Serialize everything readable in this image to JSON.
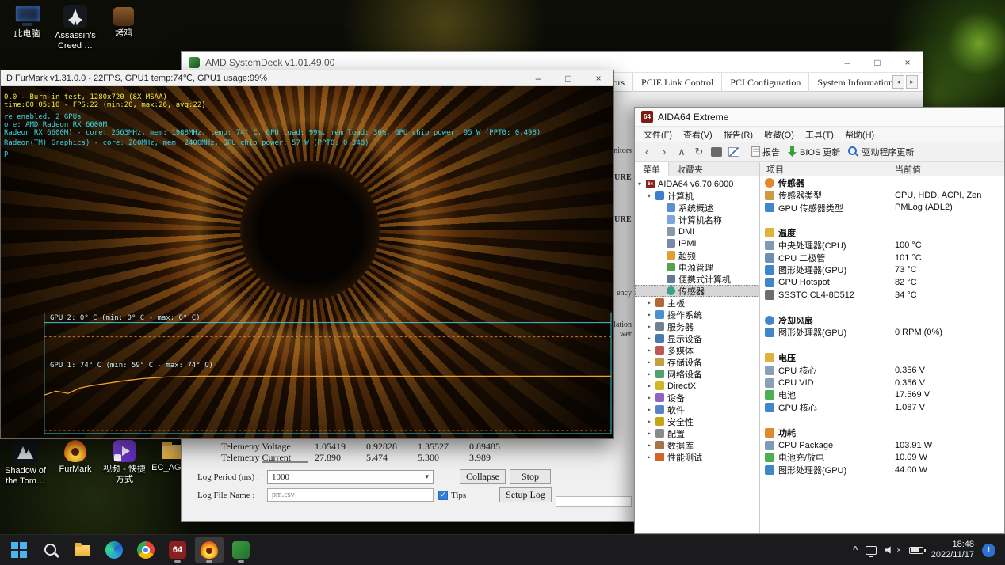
{
  "icons": {
    "minimize": "–",
    "maximize": "□",
    "close": "×",
    "back": "‹",
    "forward": "›",
    "up": "∧",
    "refresh": "↻",
    "combo_arrow": "▾",
    "check": "✓",
    "tray_chevron": "^",
    "tab_left": "◂",
    "tab_right": "▸",
    "aida_glyph": "64"
  },
  "desktop": {
    "icons_top": [
      "此电脑",
      "Assassin's Creed …",
      "烤鸡"
    ],
    "icons_bottom": [
      "Shadow of the Tom…",
      "FurMark",
      "视频 - 快捷方式",
      "EC_AGS…"
    ]
  },
  "furmark": {
    "title": "D FurMark v1.31.0.0 - 22FPS, GPU1 temp:74℃, GPU1 usage:99%",
    "overlay_lines": [
      {
        "text": "0.0 - Burn-in test, 1280x720 (8X MSAA)",
        "cls": "yellow"
      },
      {
        "text": "time:00:05:10 - FPS:22 (min:20, max:26, avg:22)",
        "cls": "yellow"
      },
      {
        "text": "re enabled, 2 GPUs",
        "cls": "cyan g1"
      },
      {
        "text": "ore: AMD Radeon RX 6600M",
        "cls": "cyan"
      },
      {
        "text": "Radeon RX 6600M) - core: 2563MHz, mem: 1988MHz, temp: 74° C, GPU load: 99%, mem load: 36%, GPU chip power: 95 W (PPT0: 0.498)",
        "cls": "cyan"
      },
      {
        "text": "Radeon(TM) Graphics) - core: 200MHz, mem: 2400MHz, GPU chip power: 57 W (PPT0: 0.348)",
        "cls": "cyan g2"
      },
      {
        "text": "p",
        "cls": "cyan g2"
      }
    ],
    "graph": {
      "gpu2_label": "GPU 2: 0° C (min: 0° C - max: 0° C)",
      "gpu1_label": "GPU 1: 74° C (min: 59° C - max: 74° C)"
    }
  },
  "systemdeck": {
    "title": "AMD SystemDeck v1.01.49.00",
    "tabs": [
      "Monitors",
      "PCIE Link Control",
      "PCI Configuration",
      "System Information"
    ],
    "fragments": [
      {
        "text": "onitors",
        "cls": "f1"
      },
      {
        "text": "CTURE",
        "cls": "f2"
      },
      {
        "text": "CTURE",
        "cls": "f3"
      },
      {
        "text": "ency",
        "cls": "f4"
      },
      {
        "text": "lation",
        "cls": "f5"
      },
      {
        "text": "wer",
        "cls": "f6"
      }
    ],
    "table_rows": [
      {
        "label": "Telemetry Voltage",
        "values": [
          "1.05419",
          "0.92828",
          "1.35527",
          "0.89485"
        ]
      },
      {
        "label": "Telemetry Current",
        "values": [
          "27.890",
          "5.474",
          "5.300",
          "3.989"
        ]
      }
    ],
    "log_period_label": "Log Period (ms) :",
    "log_period_value": "1000",
    "collapse_button": "Collapse",
    "stop_button": "Stop",
    "log_file_label": "Log File Name :",
    "log_file_value": "pm.csv",
    "tips_label": "Tips",
    "setup_button": "Setup Log"
  },
  "aida64": {
    "title": "AIDA64 Extreme",
    "menu": [
      "文件(F)",
      "查看(V)",
      "报告(R)",
      "收藏(O)",
      "工具(T)",
      "帮助(H)"
    ],
    "toolbar": {
      "report": "报告",
      "bios": "BIOS 更新",
      "driver": "驱动程序更新"
    },
    "nav_tabs": [
      "菜单",
      "收藏夹"
    ],
    "tree": [
      {
        "label": "AIDA64 v6.70.6000",
        "arrow": "▾",
        "icon": "aida",
        "glyph": "64",
        "cls": "d0"
      },
      {
        "label": "计算机",
        "arrow": "▾",
        "icon": "computer",
        "cls": "d1"
      },
      {
        "label": "系统概述",
        "arrow": "",
        "icon": "overview",
        "cls": "d2"
      },
      {
        "label": "计算机名称",
        "arrow": "",
        "icon": "name",
        "cls": "d2"
      },
      {
        "label": "DMI",
        "arrow": "",
        "icon": "dmi",
        "cls": "d2"
      },
      {
        "label": "IPMI",
        "arrow": "",
        "icon": "ipmi",
        "cls": "d2"
      },
      {
        "label": "超频",
        "arrow": "",
        "icon": "oc",
        "cls": "d2"
      },
      {
        "label": "电源管理",
        "arrow": "",
        "icon": "power",
        "cls": "d2"
      },
      {
        "label": "便携式计算机",
        "arrow": "",
        "icon": "laptop",
        "cls": "d2"
      },
      {
        "label": "传感器",
        "arrow": "",
        "icon": "sensor",
        "cls": "d2 sel"
      },
      {
        "label": "主板",
        "arrow": "▸",
        "icon": "board",
        "cls": "d1"
      },
      {
        "label": "操作系统",
        "arrow": "▸",
        "icon": "os",
        "cls": "d1"
      },
      {
        "label": "服务器",
        "arrow": "▸",
        "icon": "server",
        "cls": "d1"
      },
      {
        "label": "显示设备",
        "arrow": "▸",
        "icon": "display",
        "cls": "d1"
      },
      {
        "label": "多媒体",
        "arrow": "▸",
        "icon": "media",
        "cls": "d1"
      },
      {
        "label": "存储设备",
        "arrow": "▸",
        "icon": "storage",
        "cls": "d1"
      },
      {
        "label": "网络设备",
        "arrow": "▸",
        "icon": "network",
        "cls": "d1"
      },
      {
        "label": "DirectX",
        "arrow": "▸",
        "icon": "directx",
        "cls": "d1"
      },
      {
        "label": "设备",
        "arrow": "▸",
        "icon": "devices",
        "cls": "d1"
      },
      {
        "label": "软件",
        "arrow": "▸",
        "icon": "software",
        "cls": "d1"
      },
      {
        "label": "安全性",
        "arrow": "▸",
        "icon": "security",
        "cls": "d1"
      },
      {
        "label": "配置",
        "arrow": "▸",
        "icon": "config",
        "cls": "d1"
      },
      {
        "label": "数据库",
        "arrow": "▸",
        "icon": "database",
        "cls": "d1"
      },
      {
        "label": "性能测试",
        "arrow": "▸",
        "icon": "benchmark",
        "cls": "d1"
      }
    ],
    "columns": {
      "item": "项目",
      "value": "当前值"
    },
    "rows": [
      {
        "label": "传感器",
        "cls": "section",
        "icon": "sensor"
      },
      {
        "label": "传感器类型",
        "value": "CPU, HDD, ACPI, Zen",
        "cls": "item",
        "icon": "sensor-type"
      },
      {
        "label": "GPU 传感器类型",
        "value": "PMLog (ADL2)",
        "cls": "item",
        "icon": "gpu-sensor"
      },
      {
        "cls": "blank"
      },
      {
        "label": "温度",
        "cls": "section",
        "icon": "temperature"
      },
      {
        "label": "中央处理器(CPU)",
        "value": "100 °C",
        "cls": "item",
        "icon": "cpu"
      },
      {
        "label": "CPU 二极管",
        "value": "101 °C",
        "cls": "item",
        "icon": "diode"
      },
      {
        "label": "图形处理器(GPU)",
        "value": "73 °C",
        "cls": "item",
        "icon": "gpu"
      },
      {
        "label": "GPU Hotspot",
        "value": "82 °C",
        "cls": "item",
        "icon": "gpu"
      },
      {
        "label": "SSSTC CL4-8D512",
        "value": "34 °C",
        "cls": "item",
        "icon": "disk"
      },
      {
        "cls": "blank"
      },
      {
        "label": "冷却风扇",
        "cls": "section",
        "icon": "fan"
      },
      {
        "label": "图形处理器(GPU)",
        "value": "0 RPM (0%)",
        "cls": "item",
        "icon": "gpu"
      },
      {
        "cls": "blank"
      },
      {
        "label": "电压",
        "cls": "section",
        "icon": "voltage"
      },
      {
        "label": "CPU 核心",
        "value": "0.356 V",
        "cls": "item",
        "icon": "core"
      },
      {
        "label": "CPU VID",
        "value": "0.356 V",
        "cls": "item",
        "icon": "core"
      },
      {
        "label": "电池",
        "value": "17.569 V",
        "cls": "item",
        "icon": "battery"
      },
      {
        "label": "GPU 核心",
        "value": "1.087 V",
        "cls": "item",
        "icon": "gpu"
      },
      {
        "cls": "blank"
      },
      {
        "label": "功耗",
        "cls": "section",
        "icon": "power"
      },
      {
        "label": "CPU Package",
        "value": "103.91 W",
        "cls": "item",
        "icon": "cpu"
      },
      {
        "label": "电池充/放电",
        "value": "10.09 W",
        "cls": "item",
        "icon": "battery"
      },
      {
        "label": "图形处理器(GPU)",
        "value": "44.00 W",
        "cls": "item",
        "icon": "gpu"
      }
    ]
  },
  "taskbar": {
    "apps": [
      "start",
      "search",
      "explorer",
      "edge",
      "chrome",
      "aida64",
      "furmark",
      "systemdeck"
    ],
    "tray": {
      "time": "18:48",
      "date": "2022/11/17",
      "badge": "1"
    }
  }
}
